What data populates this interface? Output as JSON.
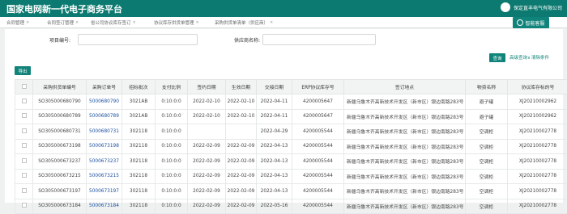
{
  "app": {
    "title": "国家电网新一代电子商务平台",
    "user": "保定直丰电气有限公司"
  },
  "breadcrumbs": [
    "合同管理",
    "合同签订管理",
    "省公司协议库存签订",
    "协议库存供货单管理",
    "采购供货单清单（供应商）"
  ],
  "ai_button": "智能客服",
  "filters": {
    "project_label": "项目编号:",
    "project_value": "",
    "supplier_label": "供应商名称:",
    "supplier_value": ""
  },
  "actions": {
    "query": "查询",
    "advanced": "高级查询∨",
    "clear": "清除条件",
    "export": "导出"
  },
  "table": {
    "columns": [
      "",
      "采购供货单编号",
      "采购订单号",
      "招标批次",
      "支付比例",
      "签约日期",
      "生效日期",
      "交接日期",
      "ERP协议库存号",
      "签订地点",
      "物资名称",
      "协议库存标的号"
    ],
    "rows": [
      [
        "SO305000680790",
        "5000680790",
        "3021AB",
        "0:10:0:0",
        "2022-02-10",
        "2022-02-10",
        "2022-04-11",
        "4200005647",
        "新疆乌鲁木齐高新技术开发区（新市区）银边南路283号",
        "避子罐",
        "XJ20210002962"
      ],
      [
        "SO305000680789",
        "5000680789",
        "3021AB",
        "0:10:0:0",
        "2022-02-10",
        "2022-02-10",
        "2022-04-11",
        "4200005647",
        "新疆乌鲁木齐高新技术开发区（新市区）银边南路283号",
        "避子罐",
        "XJ20210002962"
      ],
      [
        "SO305000680731",
        "5000680731",
        "302118",
        "0:10:0:0",
        "",
        "",
        "2022-04-29",
        "4200005544",
        "新疆乌鲁木齐高新技术开发区（新市区）银边南路283号",
        "空调柜",
        "XJ20210002778"
      ],
      [
        "SO305000673198",
        "5000673198",
        "302118",
        "0:10:0:0",
        "2022-02-09",
        "2022-02-09",
        "2022-04-13",
        "4200005544",
        "新疆乌鲁木齐高新技术开发区（新市区）银边南路283号",
        "空调柜",
        "XJ20210002778"
      ],
      [
        "SO305000673237",
        "5000673237",
        "302118",
        "0:10:0:0",
        "2022-02-09",
        "2022-02-09",
        "2022-04-13",
        "4200005544",
        "新疆乌鲁木齐高新技术开发区（新市区）银边南路283号",
        "空调柜",
        "XJ20210002778"
      ],
      [
        "SO305000673215",
        "5000673215",
        "302118",
        "0:10:0:0",
        "2022-02-09",
        "2022-02-09",
        "2022-04-13",
        "4200005544",
        "新疆乌鲁木齐高新技术开发区（新市区）银边南路283号",
        "空调柜",
        "XJ20210002778"
      ],
      [
        "SO305000673197",
        "5000673197",
        "302118",
        "0:10:0:0",
        "2022-02-09",
        "2022-02-09",
        "2022-04-13",
        "4200005544",
        "新疆乌鲁木齐高新技术开发区（新市区）银边南路283号",
        "空调柜",
        "XJ20210002778"
      ],
      [
        "SO305000673184",
        "5000673184",
        "302118",
        "0:10:0:0",
        "2022-02-09",
        "2022-02-09",
        "2022-05-16",
        "4200005544",
        "新疆乌鲁木齐高新技术开发区（新市区）银边南路283号",
        "空调柜",
        "XJ20210002778"
      ]
    ]
  }
}
